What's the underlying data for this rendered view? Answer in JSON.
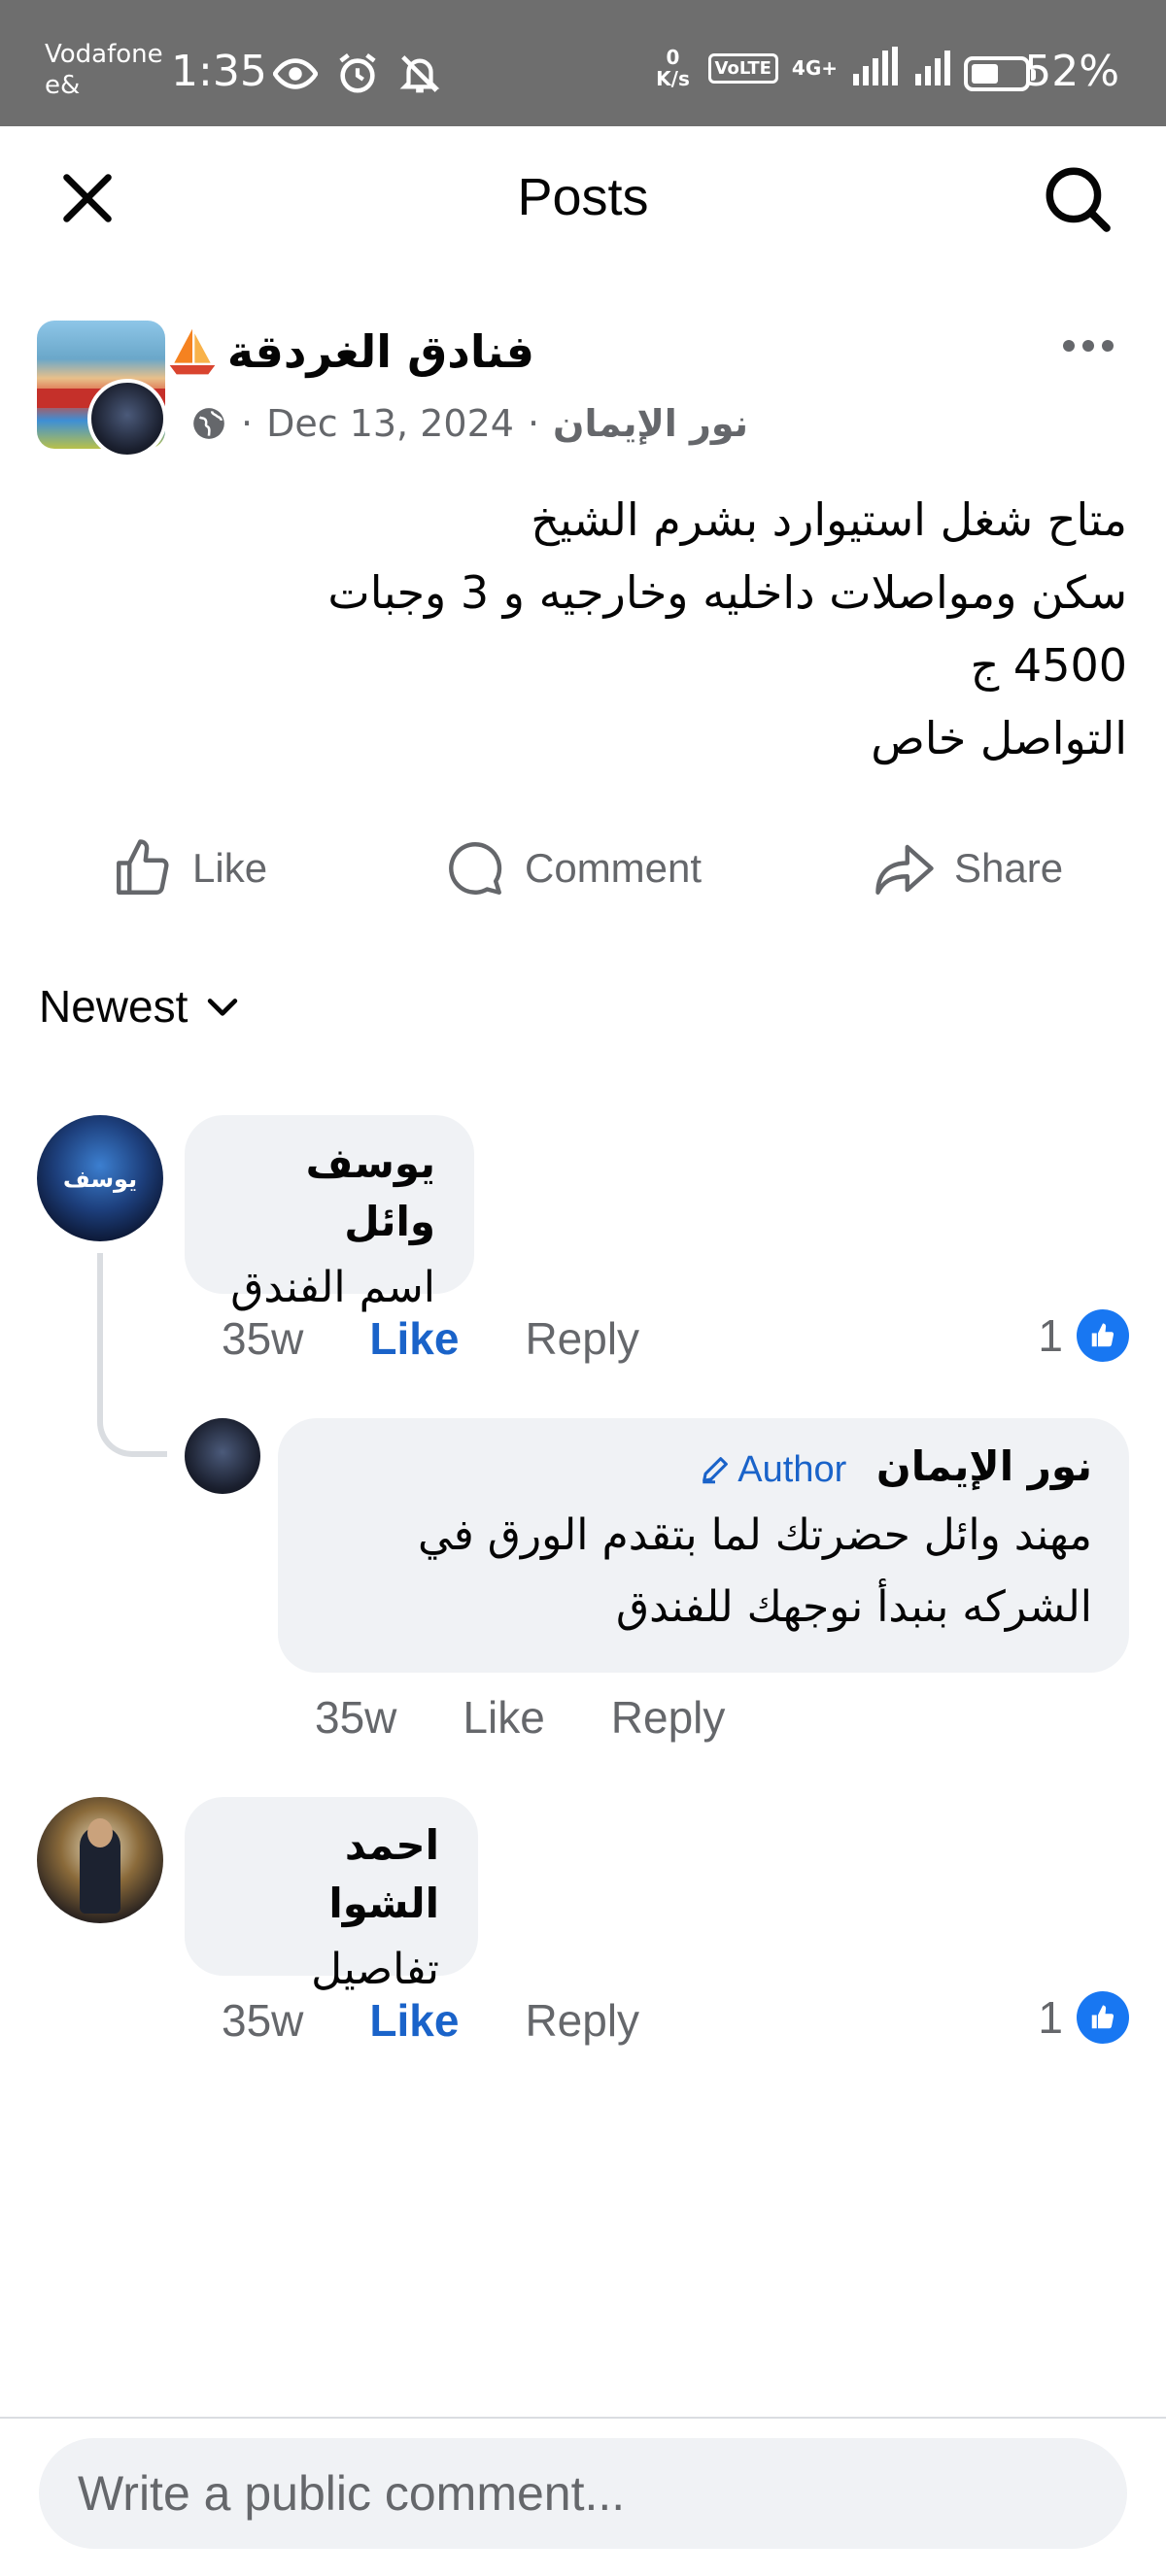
{
  "status_bar": {
    "carrier": "Vodafone e&",
    "time": "1:35",
    "net_speed": "0 K/s",
    "volte": "VoLTE",
    "network": "4G+",
    "battery_percent": "52%",
    "battery_level": 0.52,
    "icons": [
      "eye-icon",
      "alarm-icon",
      "bell-off-icon",
      "signal-icon",
      "signal-icon",
      "battery-icon"
    ]
  },
  "header": {
    "title": "Posts",
    "close_icon": "close-icon",
    "search_icon": "search-icon"
  },
  "post": {
    "page_name": "فنادق الغردقة",
    "author": "نور الإيمان",
    "date": "Dec 13, 2024",
    "separator": "·",
    "body_lines": [
      "متاح شغل استيوارد بشرم الشيخ",
      "سكن ومواصلات  داخليه وخارجيه و 3 وجبات",
      "4500 ج",
      "التواصل خاص"
    ]
  },
  "actions": {
    "like": "Like",
    "comment": "Comment",
    "share": "Share"
  },
  "sort": {
    "label": "Newest"
  },
  "comments": [
    {
      "name": "يوسف وائل",
      "avatar_text": "يوسف",
      "text": "اسم الفندق",
      "time": "35w",
      "like_label": "Like",
      "reply_label": "Reply",
      "reactions": "1"
    },
    {
      "name": "نور الإيمان",
      "badge": "Author",
      "text_lines": [
        "مهند وائل حضرتك لما بتقدم الورق في",
        "الشركه بنبدأ نوجهك للفندق"
      ],
      "time": "35w",
      "like_label": "Like",
      "reply_label": "Reply"
    },
    {
      "name": "احمد الشوا",
      "text": "تفاصيل",
      "time": "35w",
      "like_label": "Like",
      "reply_label": "Reply",
      "reactions": "1"
    }
  ],
  "composer": {
    "placeholder": "Write a public comment..."
  },
  "colors": {
    "status_bar": "#6e6e6e",
    "accent": "#1877f2",
    "link_blue": "#1a63c9",
    "bubble": "#f0f2f5",
    "secondary_text": "#65676b"
  }
}
